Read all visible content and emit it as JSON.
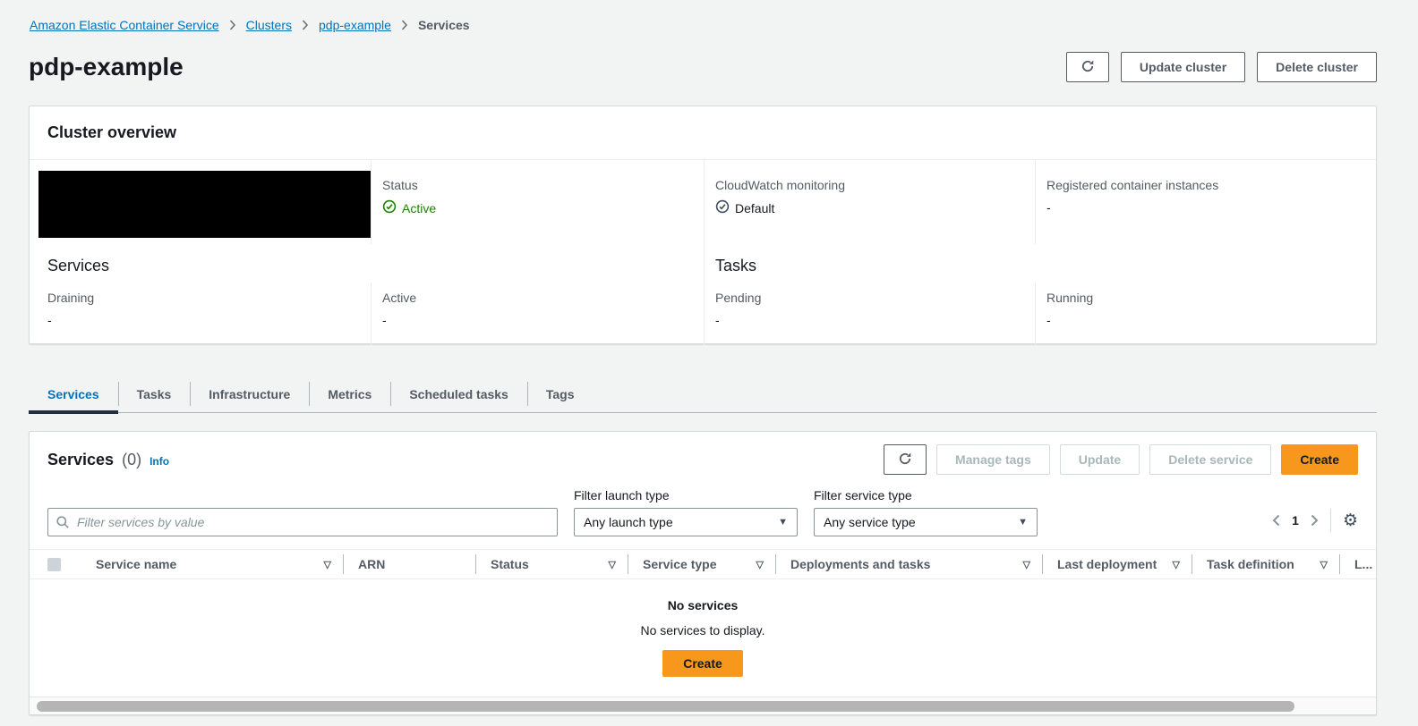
{
  "breadcrumb": {
    "items": [
      "Amazon Elastic Container Service",
      "Clusters",
      "pdp-example",
      "Services"
    ]
  },
  "page": {
    "title": "pdp-example",
    "actions": {
      "update": "Update cluster",
      "delete": "Delete cluster"
    }
  },
  "cluster_overview": {
    "title": "Cluster overview",
    "status": {
      "label": "Status",
      "value": "Active"
    },
    "cloudwatch": {
      "label": "CloudWatch monitoring",
      "value": "Default"
    },
    "registered_instances": {
      "label": "Registered container instances",
      "value": "-"
    },
    "services_section": {
      "title": "Services",
      "draining": {
        "label": "Draining",
        "value": "-"
      },
      "active": {
        "label": "Active",
        "value": "-"
      }
    },
    "tasks_section": {
      "title": "Tasks",
      "pending": {
        "label": "Pending",
        "value": "-"
      },
      "running": {
        "label": "Running",
        "value": "-"
      }
    }
  },
  "tabs": [
    {
      "label": "Services"
    },
    {
      "label": "Tasks"
    },
    {
      "label": "Infrastructure"
    },
    {
      "label": "Metrics"
    },
    {
      "label": "Scheduled tasks"
    },
    {
      "label": "Tags"
    }
  ],
  "services_panel": {
    "title": "Services",
    "count": "(0)",
    "info": "Info",
    "actions": {
      "manage_tags": "Manage tags",
      "update": "Update",
      "delete": "Delete service",
      "create": "Create"
    },
    "filters": {
      "search_placeholder": "Filter services by value",
      "launch_type": {
        "label": "Filter launch type",
        "value": "Any launch type"
      },
      "service_type": {
        "label": "Filter service type",
        "value": "Any service type"
      }
    },
    "pagination": {
      "page": "1"
    },
    "table": {
      "columns": [
        {
          "label": "Service name"
        },
        {
          "label": "ARN"
        },
        {
          "label": "Status"
        },
        {
          "label": "Service type"
        },
        {
          "label": "Deployments and tasks"
        },
        {
          "label": "Last deployment"
        },
        {
          "label": "Task definition"
        },
        {
          "label": "L..."
        }
      ]
    },
    "empty": {
      "title": "No services",
      "message": "No services to display.",
      "create": "Create"
    }
  },
  "colors": {
    "link_blue": "#0073bb",
    "active_tab_blue": "#0073bb",
    "status_green": "#1d8102",
    "primary_orange": "#f7981d",
    "redacted_black": "#000000"
  }
}
